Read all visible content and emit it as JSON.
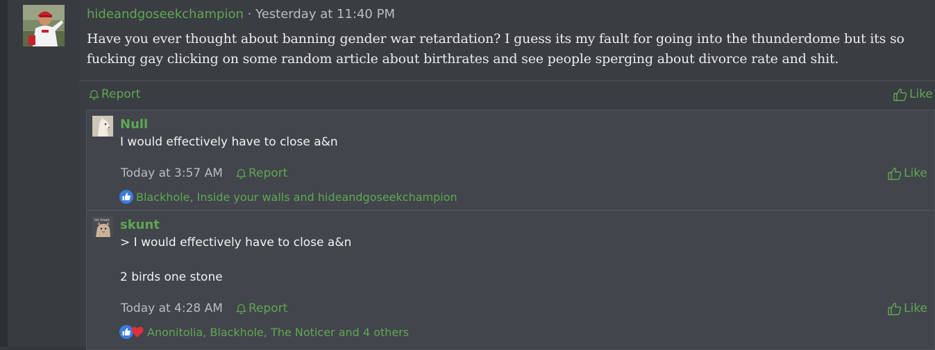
{
  "post": {
    "username": "hideandgoseekchampion",
    "separator": "·",
    "timestamp": "Yesterday at 11:40 PM",
    "text": "Have you ever thought about banning gender war retardation? I guess its my fault for going into the thunderdome but its so fucking gay clicking on some random article about birthrates and see people sperging about divorce rate and shit.",
    "report_label": "Report",
    "like_label": "Like"
  },
  "replies": [
    {
      "username": "Null",
      "lines": [
        "I would effectively have to close a&n"
      ],
      "timestamp": "Today at 3:57 AM",
      "report_label": "Report",
      "like_label": "Like",
      "reaction_icons": [
        "thumbs-up-icon"
      ],
      "reactions_text": "Blackhole, Inside your walls and hideandgoseekchampion"
    },
    {
      "username": "skunt",
      "avatar_caption": "lol lmao",
      "lines": [
        "> I would effectively have to close a&n",
        "2 birds one stone"
      ],
      "timestamp": "Today at 4:28 AM",
      "report_label": "Report",
      "like_label": "Like",
      "reaction_icons": [
        "thumbs-up-icon",
        "heart-icon"
      ],
      "reactions_text": "Anonitolia, Blackhole, The Noticer and 4 others"
    }
  ],
  "colors": {
    "accent_green": "#5ea852",
    "background": "#34373c",
    "reply_background": "#42454b",
    "like_blue": "#3b7ddd",
    "heart_red": "#e0313a"
  }
}
